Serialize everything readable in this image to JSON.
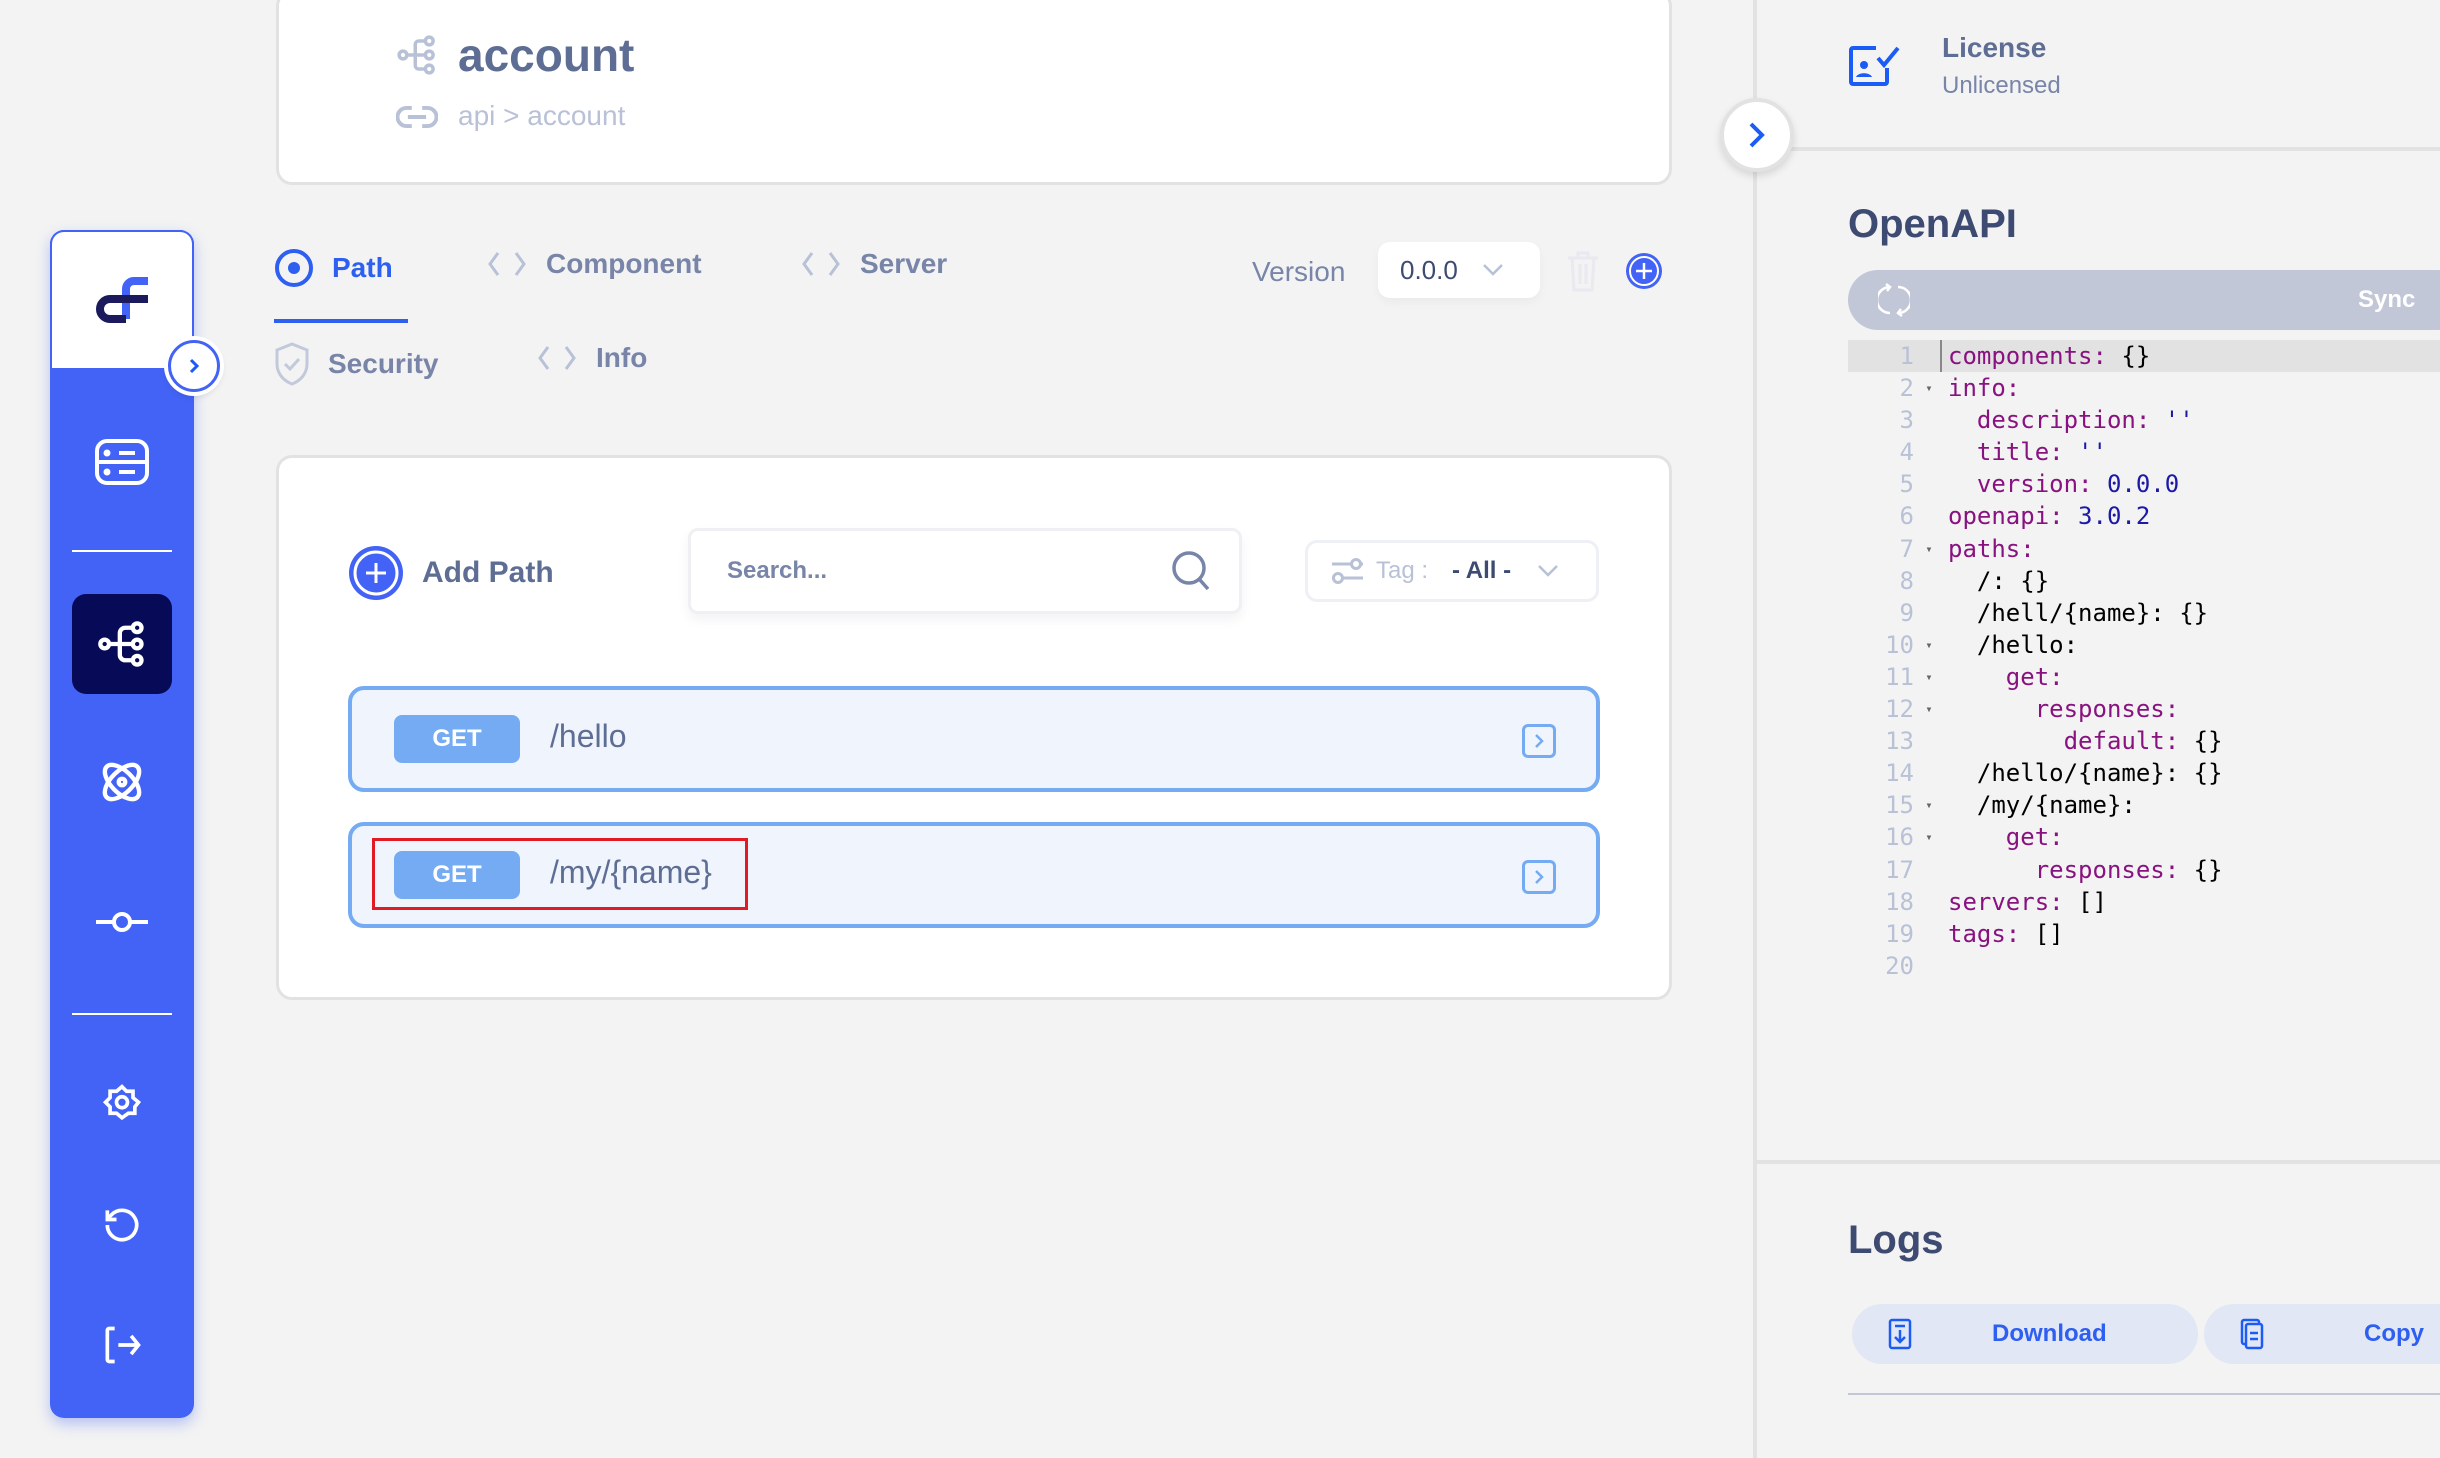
{
  "header": {
    "title": "account",
    "title_icon": "api-tree-icon",
    "breadcrumb": "api > account",
    "breadcrumb_icon": "link-icon"
  },
  "sidebar": {
    "logo": "app-logo",
    "collapse_icon": "chevron-right-icon",
    "items": [
      {
        "name": "database",
        "icon": "server-stack-icon",
        "active": false
      },
      {
        "name": "api",
        "icon": "api-tree-icon",
        "active": true
      },
      {
        "name": "components",
        "icon": "atom-icon",
        "active": false
      },
      {
        "name": "commit",
        "icon": "commit-icon",
        "active": false
      },
      {
        "name": "settings",
        "icon": "gear-icon",
        "active": false
      },
      {
        "name": "history",
        "icon": "history-icon",
        "active": false
      },
      {
        "name": "logout",
        "icon": "logout-icon",
        "active": false
      }
    ]
  },
  "tabs": [
    {
      "label": "Path",
      "icon": "radio-dot-icon",
      "active": true
    },
    {
      "label": "Component",
      "icon": "code-brackets-icon",
      "active": false
    },
    {
      "label": "Server",
      "icon": "code-brackets-icon",
      "active": false
    },
    {
      "label": "Security",
      "icon": "shield-check-icon",
      "active": false
    },
    {
      "label": "Info",
      "icon": "code-brackets-icon",
      "active": false
    }
  ],
  "version": {
    "label": "Version",
    "selected": "0.0.0"
  },
  "paths_panel": {
    "add_label": "Add Path",
    "search_placeholder": "Search...",
    "tag_label": "Tag :",
    "tag_value": "- All -",
    "rows": [
      {
        "method": "GET",
        "path": "/hello"
      },
      {
        "method": "GET",
        "path": "/my/{name}"
      }
    ]
  },
  "right_panel": {
    "license_title": "License",
    "license_status": "Unlicensed",
    "openapi_title": "OpenAPI",
    "sync_label": "Sync",
    "code_lines": [
      {
        "n": "1",
        "fold": false,
        "indent": 0,
        "key": "components",
        "val": "{}",
        "vtype": "plain"
      },
      {
        "n": "2",
        "fold": true,
        "indent": 0,
        "key": "info",
        "val": "",
        "vtype": "plain"
      },
      {
        "n": "3",
        "fold": false,
        "indent": 1,
        "key": "description",
        "val": "''",
        "vtype": "str"
      },
      {
        "n": "4",
        "fold": false,
        "indent": 1,
        "key": "title",
        "val": "''",
        "vtype": "str"
      },
      {
        "n": "5",
        "fold": false,
        "indent": 1,
        "key": "version",
        "val": "0.0.0",
        "vtype": "str"
      },
      {
        "n": "6",
        "fold": false,
        "indent": 0,
        "key": "openapi",
        "val": "3.0.2",
        "vtype": "str"
      },
      {
        "n": "7",
        "fold": true,
        "indent": 0,
        "key": "paths",
        "val": "",
        "vtype": "plain"
      },
      {
        "n": "8",
        "fold": false,
        "indent": 1,
        "key": "/",
        "val": "{}",
        "vtype": "plain",
        "plainkey": true
      },
      {
        "n": "9",
        "fold": false,
        "indent": 1,
        "key": "/hell/{name}",
        "val": "{}",
        "vtype": "plain",
        "plainkey": true
      },
      {
        "n": "10",
        "fold": true,
        "indent": 1,
        "key": "/hello",
        "val": "",
        "vtype": "plain",
        "plainkey": true
      },
      {
        "n": "11",
        "fold": true,
        "indent": 2,
        "key": "get",
        "val": "",
        "vtype": "plain"
      },
      {
        "n": "12",
        "fold": true,
        "indent": 3,
        "key": "responses",
        "val": "",
        "vtype": "plain"
      },
      {
        "n": "13",
        "fold": false,
        "indent": 4,
        "key": "default",
        "val": "{}",
        "vtype": "plain"
      },
      {
        "n": "14",
        "fold": false,
        "indent": 1,
        "key": "/hello/{name}",
        "val": "{}",
        "vtype": "plain",
        "plainkey": true
      },
      {
        "n": "15",
        "fold": true,
        "indent": 1,
        "key": "/my/{name}",
        "val": "",
        "vtype": "plain",
        "plainkey": true
      },
      {
        "n": "16",
        "fold": true,
        "indent": 2,
        "key": "get",
        "val": "",
        "vtype": "plain"
      },
      {
        "n": "17",
        "fold": false,
        "indent": 3,
        "key": "responses",
        "val": "{}",
        "vtype": "plain"
      },
      {
        "n": "18",
        "fold": false,
        "indent": 0,
        "key": "servers",
        "val": "[]",
        "vtype": "plain"
      },
      {
        "n": "19",
        "fold": false,
        "indent": 0,
        "key": "tags",
        "val": "[]",
        "vtype": "plain"
      },
      {
        "n": "20",
        "fold": false,
        "indent": 0,
        "key": "",
        "val": "",
        "vtype": "plain"
      }
    ],
    "logs_title": "Logs",
    "download_label": "Download",
    "copy_label": "Copy"
  },
  "colors": {
    "accent": "#4263f5",
    "active_nav": "#070a57",
    "get_badge": "#74abf2",
    "highlight": "#e01b24"
  }
}
